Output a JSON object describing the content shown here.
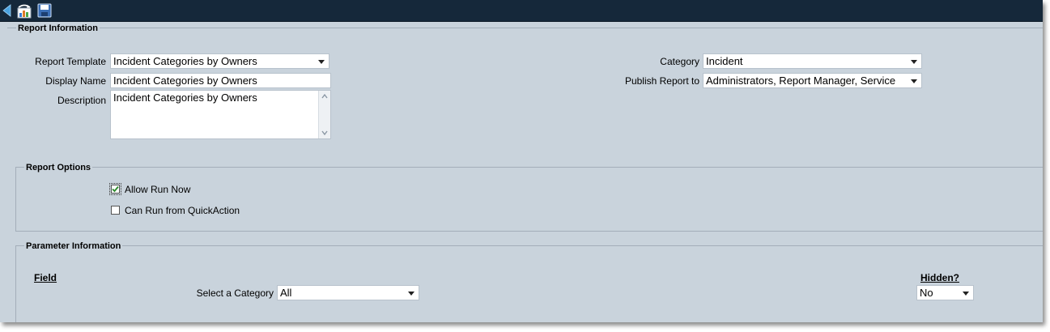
{
  "report_information": {
    "legend": "Report Information",
    "report_template": {
      "label": "Report Template",
      "value": "Incident Categories by Owners"
    },
    "display_name": {
      "label": "Display Name",
      "value": "Incident Categories by Owners"
    },
    "description": {
      "label": "Description",
      "value": "Incident Categories by Owners"
    },
    "category": {
      "label": "Category",
      "value": "Incident"
    },
    "publish_report_to": {
      "label": "Publish Report to",
      "value": "Administrators, Report Manager, Service"
    }
  },
  "report_options": {
    "legend": "Report Options",
    "allow_run_now": {
      "label": "Allow Run Now",
      "checked": true
    },
    "can_run_quickaction": {
      "label": "Can Run from QuickAction",
      "checked": false
    }
  },
  "parameter_information": {
    "legend": "Parameter Information",
    "field_header": "Field",
    "hidden_header": "Hidden?",
    "select_category": {
      "label": "Select a Category",
      "value": "All"
    },
    "hidden_value": "No"
  },
  "toolbar": {
    "icons": [
      "back-arrow-icon",
      "report-chart-icon",
      "save-icon"
    ]
  },
  "colors": {
    "toolbar_bg": "#15283a",
    "panel_bg": "#c9d3dc",
    "check_green": "#2a8a2a"
  }
}
